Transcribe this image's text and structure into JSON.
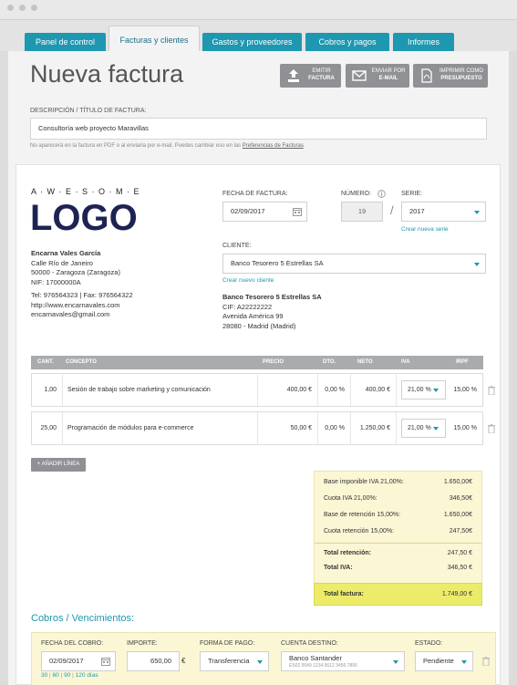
{
  "tabs": [
    {
      "label": "Panel de control"
    },
    {
      "label": "Facturas y clientes"
    },
    {
      "label": "Gastos y proveedores"
    },
    {
      "label": "Cobros y pagos"
    },
    {
      "label": "Informes"
    }
  ],
  "header": {
    "title": "Nueva factura",
    "actions": [
      {
        "line1": "EMITIR",
        "line2": "FACTURA",
        "icon": "upload-icon"
      },
      {
        "line1": "ENVIAR POR",
        "line2": "E-MAIL",
        "icon": "envelope-icon"
      },
      {
        "line1": "IMPRIMIR COMO",
        "line2": "PRESUPUESTO",
        "icon": "pdf-icon"
      }
    ]
  },
  "description": {
    "label": "DESCRIPCIÓN / TÍTULO DE FACTURA:",
    "value": "Consultoría web proyecto Maravillas",
    "hint_text": "No aparecerá en la factura en PDF o al enviarla por e-mail. Puedes cambiar eso en las ",
    "hint_link": "Preferencias de Facturas",
    "hint_end": "."
  },
  "logo": {
    "letters": "A · W · E · S · O · M · E",
    "word": "LOGO"
  },
  "emisor": {
    "name": "Encarna Vales García",
    "address1": "Calle Río de Janeiro",
    "address2": "50000 - Zaragoza (Zaragoza)",
    "nif": "NIF: 17000000A",
    "phones": "Tel: 976564323 | Fax: 976564322",
    "web": "http://www.encarnavales.com",
    "email": "encarnavales@gmail.com"
  },
  "invoice": {
    "date_label": "FECHA DE FACTURA:",
    "date_value": "02/09/2017",
    "number_label": "NÚMERO:",
    "number_value": "19",
    "serie_label": "SERIE:",
    "serie_value": "2017",
    "new_serie_link": "Crear nueva serie",
    "client_label": "CLIENTE:",
    "client_value": "Banco Tesorero 5 Estrellas SA",
    "new_client_link": "Crear nuevo cliente"
  },
  "cliente": {
    "name": "Banco Tesorero 5 Estrellas SA",
    "cif": "CIF: A22222222",
    "address1": "Avenida América 99",
    "address2": "28080 - Madrid (Madrid)"
  },
  "table": {
    "headers": [
      "CANT.",
      "CONCEPTO",
      "PRECIO",
      "DTO.",
      "NETO",
      "IVA",
      "IRPF"
    ],
    "rows": [
      {
        "cant": "1,00",
        "concepto": "Sesión de trabajo sobre marketing y comunicación",
        "precio": "400,00 €",
        "dto": "0,00 %",
        "neto": "400,00 €",
        "iva": "21,00 %",
        "irpf": "15,00 %"
      },
      {
        "cant": "25,00",
        "concepto": "Programación de módulos para e-commerce",
        "precio": "50,00 €",
        "dto": "0,00 %",
        "neto": "1.250,00 €",
        "iva": "21,00 %",
        "irpf": "15,00 %"
      }
    ],
    "add_line": "+ AÑADIR LÍNEA"
  },
  "totals": {
    "rows": [
      {
        "label": "Base imponible IVA 21,00%:",
        "value": "1.650,00€"
      },
      {
        "label": "Cuota IVA 21,00%:",
        "value": "346,50€"
      },
      {
        "label": "Base de retención 15,00%:",
        "value": "1.650,00€"
      },
      {
        "label": "Cuota retención 15,00%:",
        "value": "247,50€"
      }
    ],
    "total_retencion_label": "Total retención:",
    "total_retencion_value": "247,50 €",
    "total_iva_label": "Total IVA:",
    "total_iva_value": "346,50 €",
    "total_label": "Total factura:",
    "total_value": "1.749,00 €"
  },
  "cobros": {
    "title": "Cobros / Vencimientos:",
    "date_label": "FECHA DEL COBRO:",
    "date_value": "02/09/2017",
    "amount_label": "IMPORTE:",
    "amount_value": "650,00",
    "amount_unit": "€",
    "method_label": "FORMA DE PAGO:",
    "method_value": "Transferencia",
    "account_label": "CUENTA DESTINO:",
    "account_name": "Banco Santander",
    "account_number": "ES02 0049 1234 5612 3456 7890",
    "status_label": "ESTADO:",
    "status_value": "Pendiente",
    "days": [
      "30",
      "60",
      "90",
      "120"
    ],
    "days_suffix": "días"
  },
  "colors": {
    "accent": "#1e97b0",
    "logo": "#1d2453",
    "totals_bg": "#fbf7d5",
    "total_highlight": "#ecec6a"
  }
}
